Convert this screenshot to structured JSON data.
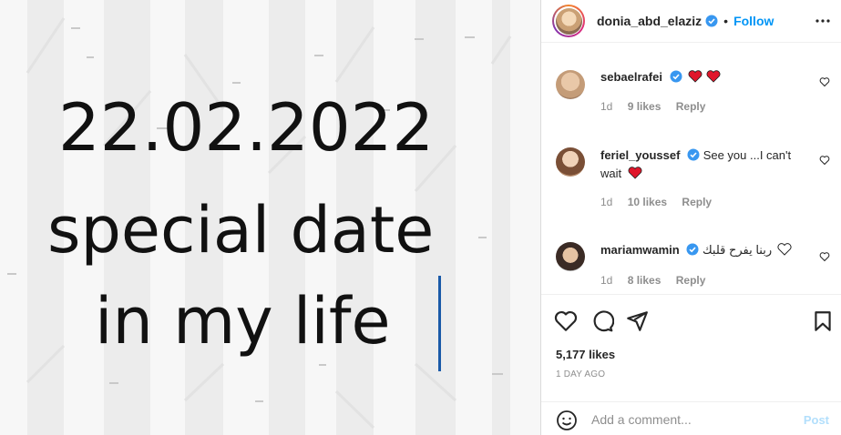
{
  "photo": {
    "line1": "22.02.2022",
    "line2": "special date",
    "line3": "in my life"
  },
  "header": {
    "username": "donia_abd_elaziz",
    "separator": "•",
    "follow_label": "Follow"
  },
  "comments": [
    {
      "user": "sebaelrafei",
      "text": "",
      "age": "1d",
      "likes": "9 likes",
      "reply": "Reply"
    },
    {
      "user": "feriel_youssef",
      "text": "See you ...I can't wait",
      "age": "1d",
      "likes": "10 likes",
      "reply": "Reply"
    },
    {
      "user": "mariamwamin",
      "text": "ربنا يفرح قلبك",
      "age": "1d",
      "likes": "8 likes",
      "reply": "Reply"
    }
  ],
  "post": {
    "likes": "5,177 likes",
    "time": "1 DAY AGO"
  },
  "add_comment": {
    "placeholder": "Add a comment...",
    "post_label": "Post"
  },
  "colors": {
    "accent": "#0095f6",
    "verified": "#3897f0",
    "heart_red": "#ed4956",
    "post_disabled": "#b2dffc"
  },
  "icons": [
    "verified-icon",
    "more-icon",
    "heart-icon",
    "comment-icon",
    "share-icon",
    "bookmark-icon",
    "emoji-icon"
  ]
}
